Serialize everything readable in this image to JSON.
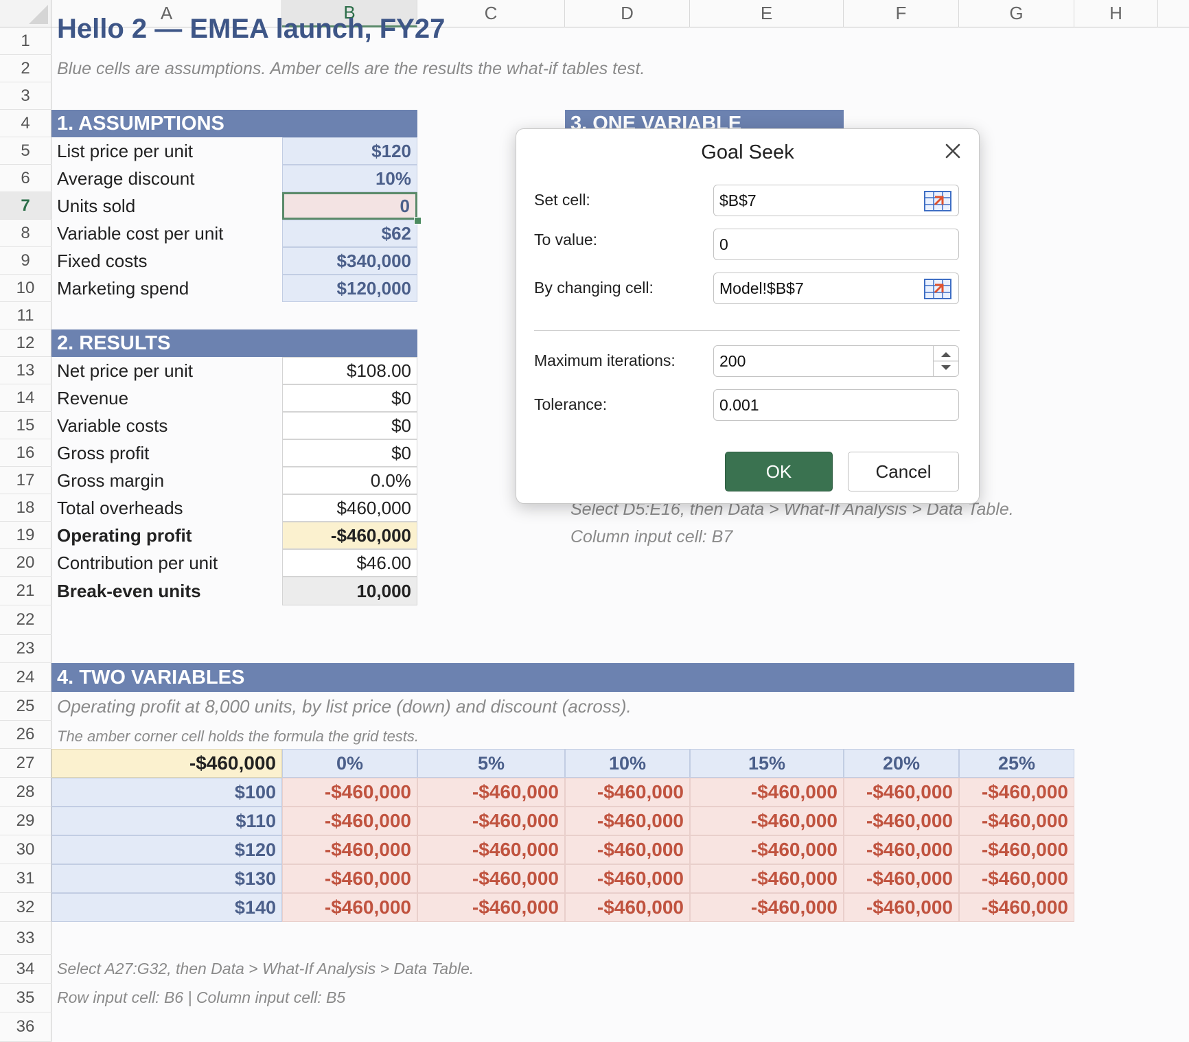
{
  "columns": [
    "A",
    "B",
    "C",
    "D",
    "E",
    "F",
    "G",
    "H"
  ],
  "selected_column": "B",
  "rows": [
    "1",
    "2",
    "3",
    "4",
    "5",
    "6",
    "7",
    "8",
    "9",
    "10",
    "11",
    "12",
    "13",
    "14",
    "15",
    "16",
    "17",
    "18",
    "19",
    "20",
    "21",
    "22",
    "23",
    "24",
    "25",
    "26",
    "27",
    "28",
    "29",
    "30",
    "31",
    "32",
    "33",
    "34",
    "35",
    "36"
  ],
  "selected_row": "7",
  "title": "Hello 2 — EMEA launch, FY27",
  "subtitle": "Blue cells are assumptions. Amber cells are the results the what-if tables test.",
  "assumptions": {
    "header": "1. ASSUMPTIONS",
    "items": [
      {
        "label": "List price per unit",
        "value": "$120"
      },
      {
        "label": "Average discount",
        "value": "10%"
      },
      {
        "label": "Units sold",
        "value": "0"
      },
      {
        "label": "Variable cost per unit",
        "value": "$62"
      },
      {
        "label": "Fixed costs",
        "value": "$340,000"
      },
      {
        "label": "Marketing spend",
        "value": "$120,000"
      }
    ]
  },
  "results": {
    "header": "2. RESULTS",
    "items": [
      {
        "label": "Net price per unit",
        "value": "$108.00"
      },
      {
        "label": "Revenue",
        "value": "$0"
      },
      {
        "label": "Variable costs",
        "value": "$0"
      },
      {
        "label": "Gross profit",
        "value": "$0"
      },
      {
        "label": "Gross margin",
        "value": "0.0%"
      },
      {
        "label": "Total overheads",
        "value": "$460,000"
      },
      {
        "label": "Operating profit",
        "value": "-$460,000"
      },
      {
        "label": "Contribution per unit",
        "value": "$46.00"
      },
      {
        "label": "Break-even units",
        "value": "10,000"
      }
    ]
  },
  "one_variable": {
    "header": "3. ONE VARIABLE",
    "note1": "Select D5:E16, then Data > What-If Analysis > Data Table.",
    "note2": "Column input cell: B7"
  },
  "two_variables": {
    "header": "4. TWO VARIABLES",
    "desc": "Operating profit at 8,000 units, by list price (down) and discount (across).",
    "desc2": "The amber corner cell holds the formula the grid tests.",
    "corner": "-$460,000",
    "discounts": [
      "0%",
      "5%",
      "10%",
      "15%",
      "20%",
      "25%"
    ],
    "prices": [
      "$100",
      "$110",
      "$120",
      "$130",
      "$140"
    ],
    "grid": [
      [
        "-$460,000",
        "-$460,000",
        "-$460,000",
        "-$460,000",
        "-$460,000",
        "-$460,000"
      ],
      [
        "-$460,000",
        "-$460,000",
        "-$460,000",
        "-$460,000",
        "-$460,000",
        "-$460,000"
      ],
      [
        "-$460,000",
        "-$460,000",
        "-$460,000",
        "-$460,000",
        "-$460,000",
        "-$460,000"
      ],
      [
        "-$460,000",
        "-$460,000",
        "-$460,000",
        "-$460,000",
        "-$460,000",
        "-$460,000"
      ],
      [
        "-$460,000",
        "-$460,000",
        "-$460,000",
        "-$460,000",
        "-$460,000",
        "-$460,000"
      ]
    ],
    "note1": "Select A27:G32, then Data > What-If Analysis > Data Table.",
    "note2": "Row input cell: B6   |   Column input cell: B5"
  },
  "goal_seek": {
    "title": "Goal Seek",
    "set_cell_label": "Set cell:",
    "set_cell_value": "$B$7",
    "to_value_label": "To value:",
    "to_value_value": "0",
    "changing_label": "By changing cell:",
    "changing_value": "Model!$B$7",
    "max_iter_label": "Maximum iterations:",
    "max_iter_value": "200",
    "tolerance_label": "Tolerance:",
    "tolerance_value": "0.001",
    "ok_label": "OK",
    "cancel_label": "Cancel"
  },
  "colors": {
    "band": "#6c82b0",
    "assumption_fill": "#e3eaf7",
    "result_highlight": "#fbf1cf",
    "negative_grid_fill": "#f8e4e1",
    "negative_text": "#c0533f",
    "ok_button": "#3a7250"
  },
  "icons": [
    "range-select-icon",
    "close-icon",
    "spin-up-icon",
    "spin-down-icon"
  ]
}
